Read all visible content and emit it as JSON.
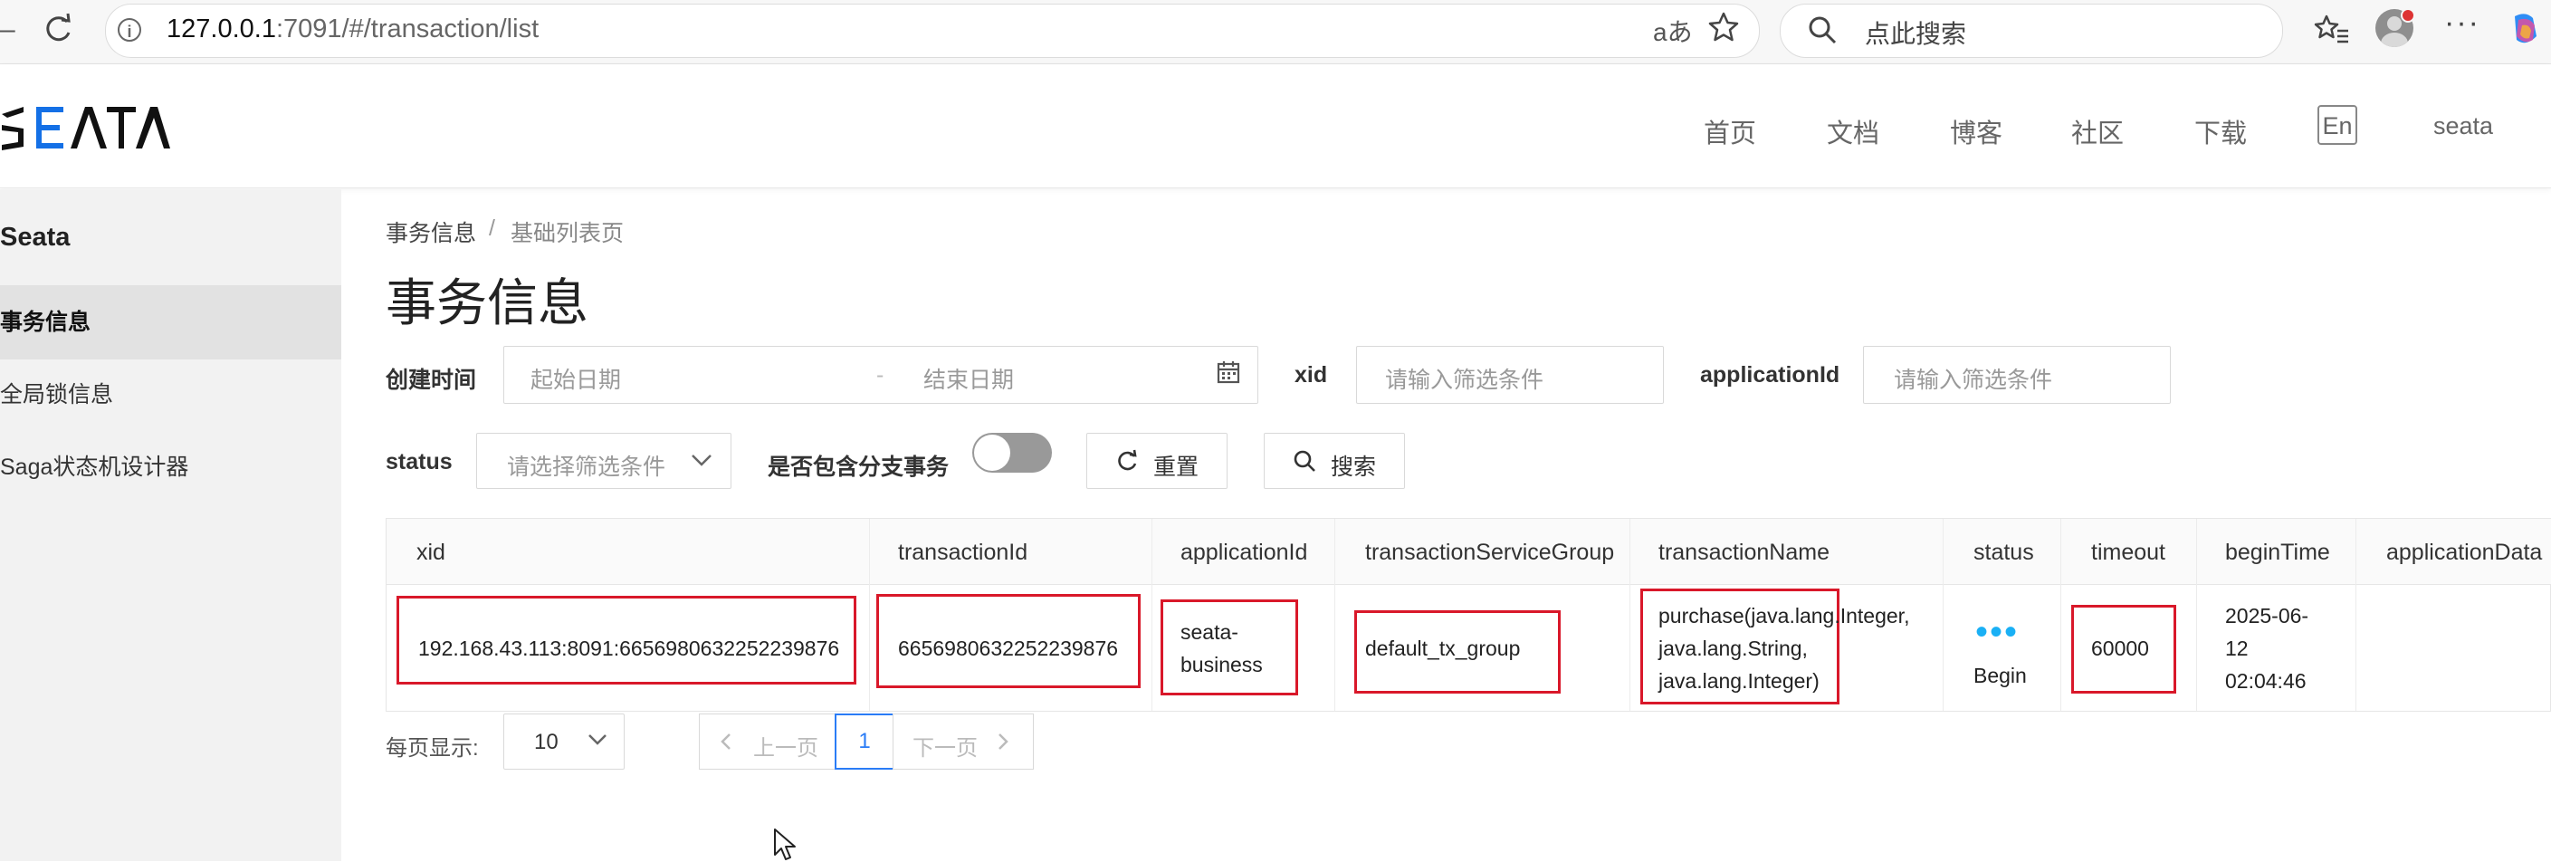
{
  "browser": {
    "url_host": "127.0.0.1",
    "url_rest": ":7091/#/transaction/list",
    "read_aloud_glyph": "aあ",
    "search_placeholder": "点此搜索"
  },
  "header": {
    "logo_text": "SEATA",
    "nav": [
      "首页",
      "文档",
      "博客",
      "社区",
      "下载"
    ],
    "lang_label": "En",
    "user": "seata"
  },
  "sidebar": {
    "title": "Seata",
    "items": [
      {
        "label": "事务信息",
        "active": true
      },
      {
        "label": "全局锁信息",
        "active": false
      },
      {
        "label": "Saga状态机设计器",
        "active": false
      }
    ]
  },
  "breadcrumb": [
    "事务信息",
    "基础列表页"
  ],
  "breadcrumb_sep": "/",
  "page_title": "事务信息",
  "filters": {
    "create_time_label": "创建时间",
    "start_placeholder": "起始日期",
    "range_sep": "-",
    "end_placeholder": "结束日期",
    "xid_label": "xid",
    "xid_placeholder": "请输入筛选条件",
    "app_label": "applicationId",
    "app_placeholder": "请输入筛选条件",
    "status_label": "status",
    "status_placeholder": "请选择筛选条件",
    "branch_label": "是否包含分支事务",
    "reset_label": "重置",
    "search_label": "搜索"
  },
  "table": {
    "columns": [
      "xid",
      "transactionId",
      "applicationId",
      "transactionServiceGroup",
      "transactionName",
      "status",
      "timeout",
      "beginTime",
      "applicationData"
    ],
    "rows": [
      {
        "xid": "192.168.43.113:8091:6656980632252239876",
        "transactionId": "6656980632252239876",
        "applicationId_lines": [
          "seata-",
          "business"
        ],
        "transactionServiceGroup": "default_tx_group",
        "transactionName_lines": [
          "purchase(java.lang.Integer,",
          "java.lang.String,",
          "java.lang.Integer)"
        ],
        "status_dots": "•••",
        "status": "Begin",
        "timeout": "60000",
        "beginTime_lines": [
          "2025-06-",
          "12",
          "02:04:46"
        ],
        "applicationData": ""
      }
    ]
  },
  "pagination": {
    "page_size_label": "每页显示:",
    "page_size": "10",
    "prev_label": "上一页",
    "current_page": "1",
    "next_label": "下一页"
  },
  "colors": {
    "highlight_red": "#d9182a",
    "accent_blue": "#1ab0f5",
    "active_page": "#2a7cf6"
  }
}
